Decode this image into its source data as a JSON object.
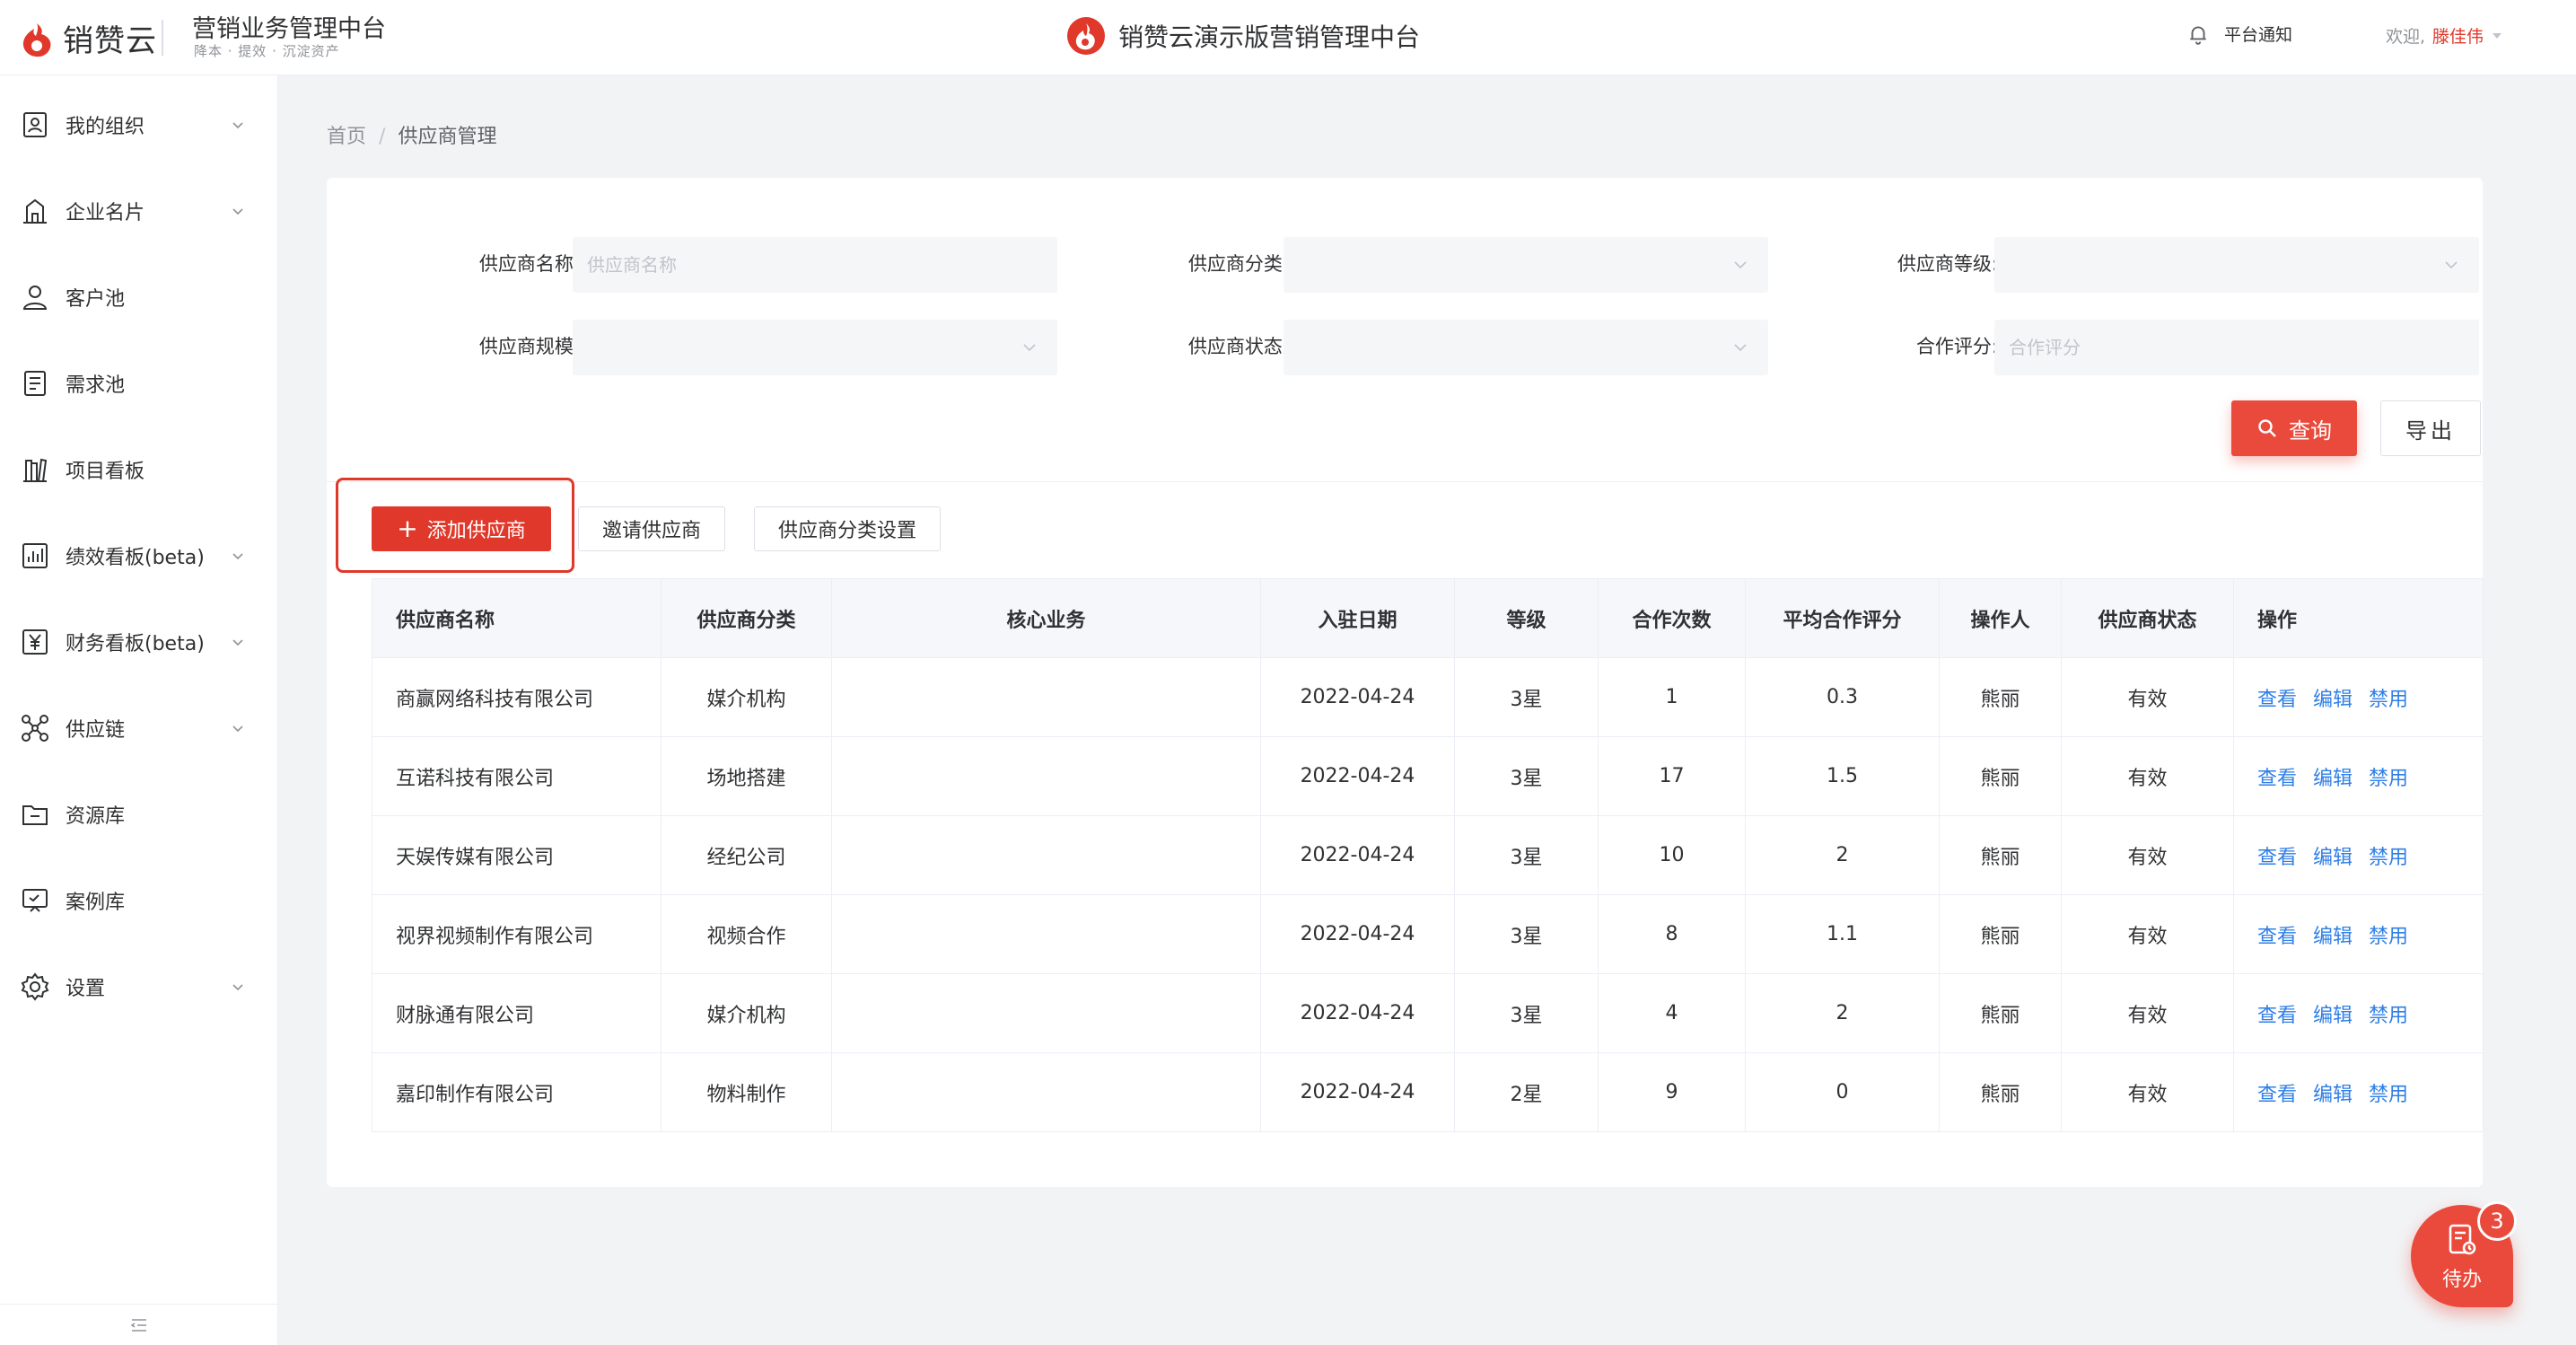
{
  "brand": {
    "logo_text": "销赞云",
    "system_title": "营销业务管理中台",
    "system_subtitle": "降本 · 提效 · 沉淀资产"
  },
  "header": {
    "center_title": "销赞云演示版营销管理中台",
    "notice_label": "平台通知",
    "welcome_label": "欢迎,",
    "user_name": "滕佳伟"
  },
  "sidebar": {
    "items": [
      {
        "label": "我的组织",
        "icon": "org-icon",
        "has_chevron": true
      },
      {
        "label": "企业名片",
        "icon": "business-card-icon",
        "has_chevron": true
      },
      {
        "label": "客户池",
        "icon": "customer-icon",
        "has_chevron": false
      },
      {
        "label": "需求池",
        "icon": "demand-icon",
        "has_chevron": false
      },
      {
        "label": "项目看板",
        "icon": "project-board-icon",
        "has_chevron": false
      },
      {
        "label": "绩效看板(beta)",
        "icon": "chart-icon",
        "has_chevron": true
      },
      {
        "label": "财务看板(beta)",
        "icon": "finance-icon",
        "has_chevron": true
      },
      {
        "label": "供应链",
        "icon": "supply-chain-icon",
        "has_chevron": true
      },
      {
        "label": "资源库",
        "icon": "folder-icon",
        "has_chevron": false
      },
      {
        "label": "案例库",
        "icon": "case-icon",
        "has_chevron": false
      },
      {
        "label": "设置",
        "icon": "gear-icon",
        "has_chevron": true
      }
    ]
  },
  "breadcrumb": {
    "home": "首页",
    "separator": "/",
    "current": "供应商管理"
  },
  "filters": {
    "name_label": "供应商名称:",
    "name_placeholder": "供应商名称",
    "category_label": "供应商分类:",
    "level_label": "供应商等级:",
    "scale_label": "供应商规模:",
    "status_label": "供应商状态:",
    "rating_label": "合作评分:",
    "rating_placeholder": "合作评分"
  },
  "actions": {
    "query": "查询",
    "export": "导出",
    "add": "添加供应商",
    "invite": "邀请供应商",
    "category_settings": "供应商分类设置"
  },
  "table": {
    "columns": [
      "供应商名称",
      "供应商分类",
      "核心业务",
      "入驻日期",
      "等级",
      "合作次数",
      "平均合作评分",
      "操作人",
      "供应商状态",
      "操作"
    ],
    "row_actions": [
      "查看",
      "编辑",
      "禁用"
    ],
    "rows": [
      {
        "name": "商赢网络科技有限公司",
        "category": "媒介机构",
        "core": "",
        "date": "2022-04-24",
        "level": "3星",
        "count": "1",
        "rating": "0.3",
        "operator": "熊丽",
        "status": "有效"
      },
      {
        "name": "互诺科技有限公司",
        "category": "场地搭建",
        "core": "",
        "date": "2022-04-24",
        "level": "3星",
        "count": "17",
        "rating": "1.5",
        "operator": "熊丽",
        "status": "有效"
      },
      {
        "name": "天娱传媒有限公司",
        "category": "经纪公司",
        "core": "",
        "date": "2022-04-24",
        "level": "3星",
        "count": "10",
        "rating": "2",
        "operator": "熊丽",
        "status": "有效"
      },
      {
        "name": "视界视频制作有限公司",
        "category": "视频合作",
        "core": "",
        "date": "2022-04-24",
        "level": "3星",
        "count": "8",
        "rating": "1.1",
        "operator": "熊丽",
        "status": "有效"
      },
      {
        "name": "财脉通有限公司",
        "category": "媒介机构",
        "core": "",
        "date": "2022-04-24",
        "level": "3星",
        "count": "4",
        "rating": "2",
        "operator": "熊丽",
        "status": "有效"
      },
      {
        "name": "嘉印制作有限公司",
        "category": "物料制作",
        "core": "",
        "date": "2022-04-24",
        "level": "2星",
        "count": "9",
        "rating": "0",
        "operator": "熊丽",
        "status": "有效"
      }
    ]
  },
  "todo": {
    "label": "待办",
    "badge": "3"
  },
  "colors": {
    "brand_red": "#e0392b",
    "link_blue": "#2f7fe6",
    "bg": "#f2f3f5"
  }
}
